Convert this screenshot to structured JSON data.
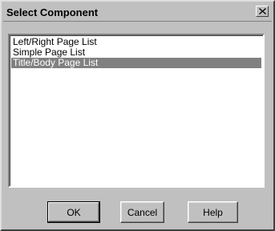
{
  "window": {
    "title": "Select Component",
    "close_icon": "close-icon"
  },
  "list": {
    "items": [
      {
        "label": "Left/Right Page List",
        "selected": false
      },
      {
        "label": "Simple Page List",
        "selected": false
      },
      {
        "label": "Title/Body Page List",
        "selected": true
      }
    ],
    "selection_color": "#808080"
  },
  "buttons": {
    "ok_label": "OK",
    "cancel_label": "Cancel",
    "help_label": "Help"
  }
}
